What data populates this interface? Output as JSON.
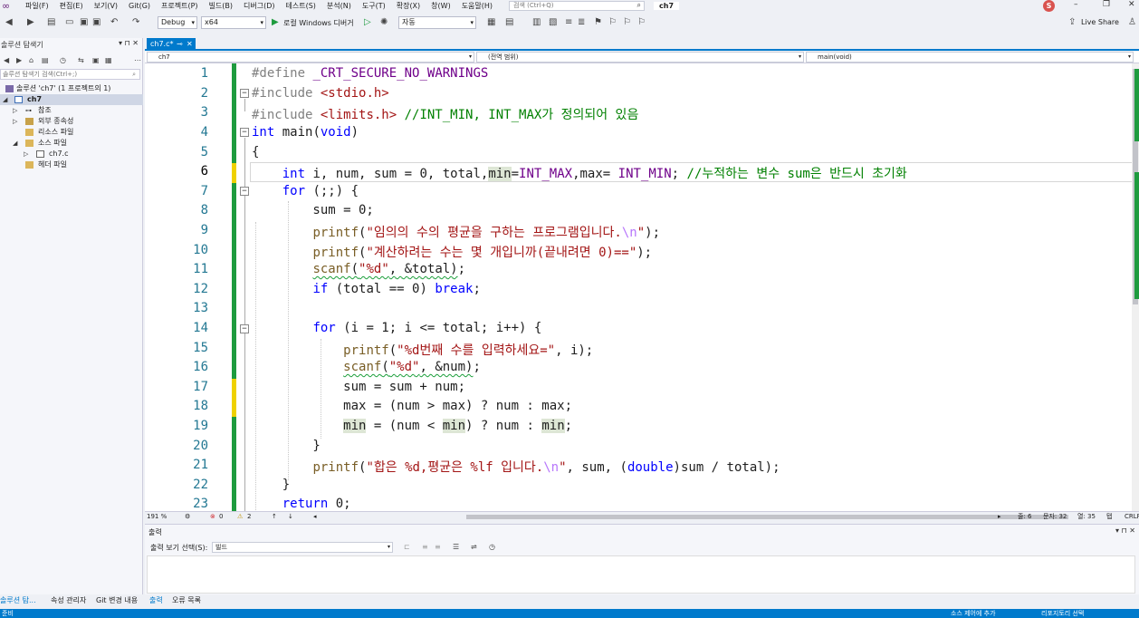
{
  "menubar": {
    "items": [
      "파일(F)",
      "편집(E)",
      "보기(V)",
      "Git(G)",
      "프로젝트(P)",
      "빌드(B)",
      "디버그(D)",
      "테스트(S)",
      "분석(N)",
      "도구(T)",
      "확장(X)",
      "창(W)",
      "도움말(H)"
    ],
    "search_placeholder": "검색 (Ctrl+Q)",
    "solution_title": "ch7",
    "user_initial": "S"
  },
  "toolbar": {
    "config": "Debug",
    "platform": "x64",
    "debugger": "로컬 Windows 디버거",
    "auto": "자동",
    "live_share": "Live Share"
  },
  "solution_explorer": {
    "title": "솔루션 탐색기",
    "search_placeholder": "솔루션 탐색기 검색(Ctrl+;)",
    "tree": [
      {
        "label": "솔루션 'ch7' (1 프로젝트의 1)",
        "level": 0,
        "selected": false
      },
      {
        "label": "ch7",
        "level": 1,
        "selected": true
      },
      {
        "label": "참조",
        "level": 2,
        "selected": false
      },
      {
        "label": "외부 종속성",
        "level": 2,
        "selected": false
      },
      {
        "label": "리소스 파일",
        "level": 2,
        "selected": false
      },
      {
        "label": "소스 파일",
        "level": 2,
        "selected": false
      },
      {
        "label": "ch7.c",
        "level": 3,
        "selected": false
      },
      {
        "label": "헤더 파일",
        "level": 2,
        "selected": false
      }
    ]
  },
  "bottom_tabs": [
    "솔루션 탐...",
    "속성 관리자",
    "Git 변경 내용",
    "출력",
    "오류 목록"
  ],
  "editor": {
    "tab": "ch7.c*",
    "nav_project": "ch7",
    "nav_scope": "(전역 범위)",
    "nav_function": "main(void)",
    "lines": [
      {
        "n": "1",
        "text": "#define _CRT_SECURE_NO_WARNINGS"
      },
      {
        "n": "2",
        "text": "#include <stdio.h>"
      },
      {
        "n": "3",
        "text": "#include <limits.h> //INT_MIN, INT_MAX가 정의되어 있음"
      },
      {
        "n": "4",
        "text": "int main(void)"
      },
      {
        "n": "5",
        "text": "{"
      },
      {
        "n": "6",
        "text": "int i, num, sum = 0, total,min=INT_MAX,max= INT_MIN; //누적하는 변수 sum은 반드시 초기화"
      },
      {
        "n": "7",
        "text": "for (;;) {"
      },
      {
        "n": "8",
        "text": "sum = 0;"
      },
      {
        "n": "9",
        "text": "printf(\"임의의 수의 평균을 구하는 프로그램입니다.\\n\");"
      },
      {
        "n": "10",
        "text": "printf(\"계산하려는 수는 몇 개입니까(끝내려면 0)==\");"
      },
      {
        "n": "11",
        "text": "scanf(\"%d\", &total);"
      },
      {
        "n": "12",
        "text": "if (total == 0) break;"
      },
      {
        "n": "13",
        "text": ""
      },
      {
        "n": "14",
        "text": "for (i = 1; i <= total; i++) {"
      },
      {
        "n": "15",
        "text": "printf(\"%d번째 수를 입력하세요=\", i);"
      },
      {
        "n": "16",
        "text": "scanf(\"%d\", &num);"
      },
      {
        "n": "17",
        "text": "sum = sum + num;"
      },
      {
        "n": "18",
        "text": "max = (num > max) ? num : max;"
      },
      {
        "n": "19",
        "text": "min = (num < min) ? num : min;"
      },
      {
        "n": "20",
        "text": "}"
      },
      {
        "n": "21",
        "text": "printf(\"합은 %d,평균은 %lf 입니다.\\n\", sum, (double)sum / total);"
      },
      {
        "n": "22",
        "text": "}"
      },
      {
        "n": "23",
        "text": "return 0;"
      }
    ]
  },
  "editor_status": {
    "zoom": "191 %",
    "errors": "0",
    "warnings": "2",
    "line": "줄: 6",
    "char": "문자: 32",
    "col": "열: 35",
    "tab": "탭",
    "eol": "CRLF"
  },
  "output": {
    "title": "출력",
    "show_from_label": "출력 보기 선택(S):",
    "show_from_value": "빌드"
  },
  "statusbar": {
    "ready": "준비",
    "source_control": "소스 제어에 추가",
    "repo": "리포지토리 선택"
  }
}
